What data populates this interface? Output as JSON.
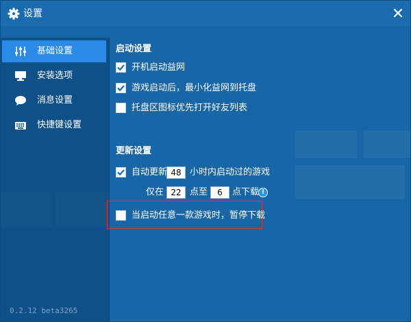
{
  "window": {
    "title": "设置",
    "title_icon": "gear-icon",
    "close_icon": "close-icon"
  },
  "sidebar": {
    "items": [
      {
        "label": "基础设置",
        "icon": "sliders-icon",
        "active": true
      },
      {
        "label": "安装选项",
        "icon": "monitor-icon",
        "active": false
      },
      {
        "label": "消息设置",
        "icon": "chat-bubble-icon",
        "active": false
      },
      {
        "label": "快捷键设置",
        "icon": "keyboard-icon",
        "active": false
      }
    ]
  },
  "startup": {
    "title": "启动设置",
    "options": [
      {
        "label": "开机启动益网",
        "checked": true
      },
      {
        "label": "游戏启动后，最小化益网到托盘",
        "checked": true
      },
      {
        "label": "托盘区图标优先打开好友列表",
        "checked": false
      }
    ]
  },
  "update": {
    "title": "更新设置",
    "auto_update": {
      "checked": true,
      "prefix": "自动更新",
      "hours": "48",
      "suffix": "小时内启动过的游戏"
    },
    "schedule": {
      "prefix": "仅在",
      "start": "22",
      "middle": "点至",
      "end": "6",
      "suffix": "点下载",
      "info_icon": "info-icon"
    },
    "pause_option": {
      "label": "当启动任意一款游戏时，暂停下载",
      "checked": false
    }
  },
  "version": "0.2.12 beta3265",
  "colors": {
    "background": "#1866a6",
    "active_nav": "#2a8ae6",
    "checkmark": "#1a6cae",
    "highlight_border": "#e0343a",
    "info": "#1e9bf0"
  }
}
